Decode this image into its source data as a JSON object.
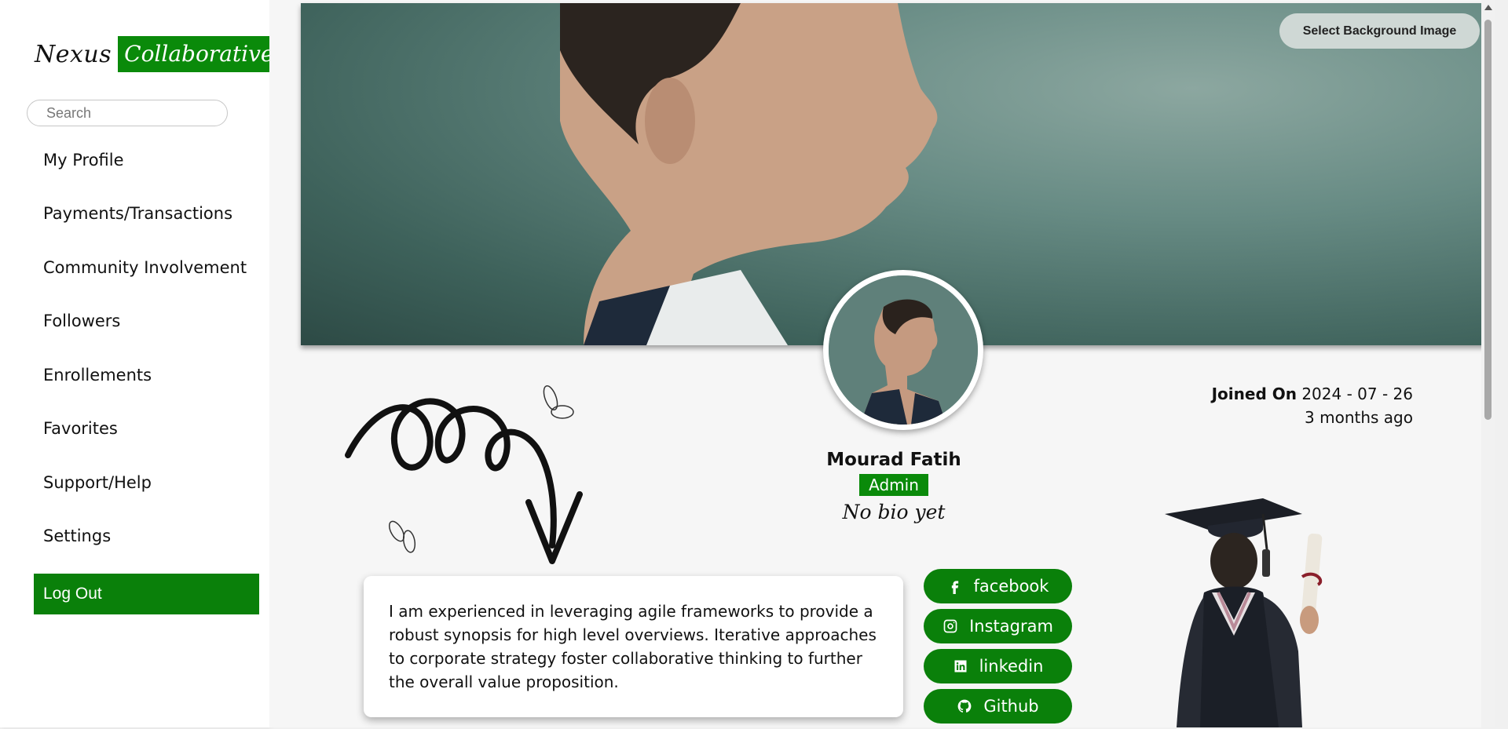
{
  "brand": {
    "name_part1": "Nexus",
    "name_part2": "Collaborative",
    "accent_color": "#0a8a0a"
  },
  "search": {
    "placeholder": "Search"
  },
  "sidebar": {
    "items": [
      {
        "label": "My Profile"
      },
      {
        "label": "Payments/Transactions"
      },
      {
        "label": "Community Involvement"
      },
      {
        "label": "Followers"
      },
      {
        "label": "Enrollements"
      },
      {
        "label": "Favorites"
      },
      {
        "label": "Support/Help"
      },
      {
        "label": "Settings"
      }
    ],
    "logout_label": "Log Out"
  },
  "banner": {
    "select_bg_label": "Select Background Image"
  },
  "profile": {
    "joined_label": "Joined On",
    "joined_date": "2024 - 07 - 26",
    "joined_relative": "3 months ago",
    "name": "Mourad Fatih",
    "role": "Admin",
    "bio": "No bio yet",
    "about": "I am experienced in leveraging agile frameworks to provide a robust synopsis for high level overviews. Iterative approaches to corporate strategy foster collaborative thinking to further the overall value proposition."
  },
  "socials": [
    {
      "label": "facebook",
      "icon": "facebook-icon"
    },
    {
      "label": "Instagram",
      "icon": "instagram-icon"
    },
    {
      "label": "linkedin",
      "icon": "linkedin-icon"
    },
    {
      "label": "Github",
      "icon": "github-icon"
    }
  ]
}
